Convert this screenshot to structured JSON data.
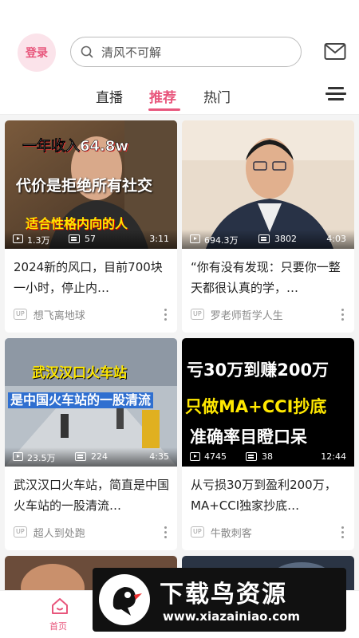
{
  "header": {
    "login_label": "登录",
    "search_placeholder": "清风不可解"
  },
  "tabs": [
    {
      "label": "直播",
      "active": false
    },
    {
      "label": "推荐",
      "active": true
    },
    {
      "label": "热门",
      "active": false
    }
  ],
  "videos": [
    {
      "overlay": [
        "一年收入64.8w",
        "代价是拒绝所有社交",
        "适合性格内向的人"
      ],
      "views": "1.3万",
      "comments": "57",
      "duration": "3:11",
      "title": "2024新的风口，目前700块一小时，停止内…",
      "author": "想飞离地球"
    },
    {
      "overlay": [],
      "views": "694.3万",
      "comments": "3802",
      "duration": "4:03",
      "title": "“你有没有发现：只要你一整天都很认真的学，…",
      "author": "罗老师哲学人生"
    },
    {
      "overlay": [
        "武汉汉口火车站",
        "是中国火车站的一股清流"
      ],
      "views": "23.5万",
      "comments": "224",
      "duration": "4:35",
      "title": "武汉汉口火车站，简直是中国火车站的一股清流…",
      "author": "超人到处跑"
    },
    {
      "overlay": [
        "亏30万到赚200万",
        "只做MA+CCI抄底",
        "准确率目瞪口呆"
      ],
      "views": "4745",
      "comments": "38",
      "duration": "12:44",
      "title": "从亏损30万到盈利200万，MA+CCI独家抄底…",
      "author": "牛散刺客"
    }
  ],
  "up_badge": "UP",
  "bottom_nav": {
    "home_label": "首页"
  },
  "watermark": {
    "title": "下载鸟资源",
    "url": "www.xiazainiao.com"
  },
  "colors": {
    "accent": "#e8567c"
  }
}
